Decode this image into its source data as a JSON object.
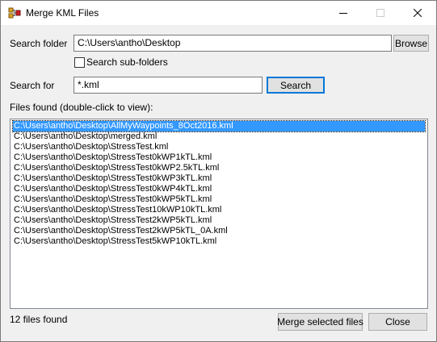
{
  "window": {
    "title": "Merge KML Files",
    "icon": "kml-app-icon",
    "controls": {
      "minimize": "minimize-icon",
      "maximize": "maximize-icon",
      "close": "close-icon"
    }
  },
  "search_folder": {
    "label": "Search folder",
    "value": "C:\\Users\\antho\\Desktop",
    "browse_label": "Browse"
  },
  "subfolders": {
    "label": "Search sub-folders",
    "checked": false
  },
  "search_for": {
    "label": "Search for",
    "value": "*.kml",
    "button_label": "Search"
  },
  "files": {
    "label": "Files found (double-click to view):",
    "items": [
      "C:\\Users\\antho\\Desktop\\AllMyWaypoints_8Oct2016.kml",
      "C:\\Users\\antho\\Desktop\\merged.kml",
      "C:\\Users\\antho\\Desktop\\StressTest.kml",
      "C:\\Users\\antho\\Desktop\\StressTest0kWP1kTL.kml",
      "C:\\Users\\antho\\Desktop\\StressTest0kWP2.5kTL.kml",
      "C:\\Users\\antho\\Desktop\\StressTest0kWP3kTL.kml",
      "C:\\Users\\antho\\Desktop\\StressTest0kWP4kTL.kml",
      "C:\\Users\\antho\\Desktop\\StressTest0kWP5kTL.kml",
      "C:\\Users\\antho\\Desktop\\StressTest10kWP10kTL.kml",
      "C:\\Users\\antho\\Desktop\\StressTest2kWP5kTL.kml",
      "C:\\Users\\antho\\Desktop\\StressTest2kWP5kTL_0A.kml",
      "C:\\Users\\antho\\Desktop\\StressTest5kWP10kTL.kml"
    ],
    "selected_index": 0
  },
  "footer": {
    "status": "12 files found",
    "merge_label": "Merge selected files",
    "close_label": "Close"
  },
  "colors": {
    "selection": "#3399ff",
    "default_button_border": "#0078d7"
  }
}
